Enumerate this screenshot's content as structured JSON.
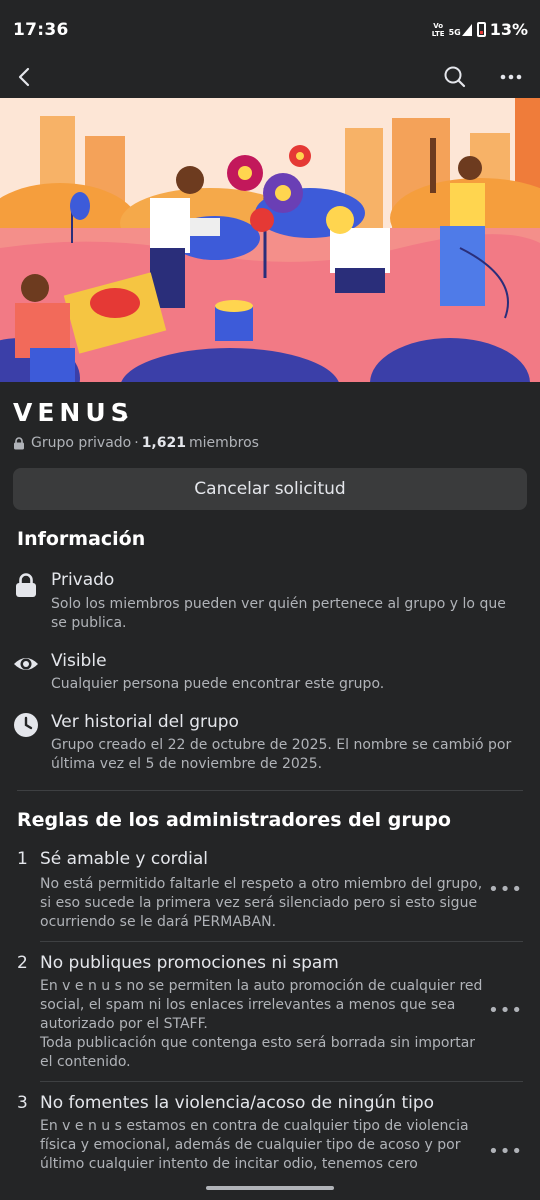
{
  "status_bar": {
    "time": "17:36",
    "volte": "Vo\nLTE",
    "network": "5G",
    "battery": "13%"
  },
  "app_bar": {
    "back_icon": "back-arrow-icon",
    "search_icon": "search-icon",
    "more_icon": "more-options-icon"
  },
  "group": {
    "name": "VENUS",
    "chevron": "›",
    "privacy": "Grupo privado",
    "separator": "·",
    "members_count": "1,621",
    "members_label": "miembros",
    "cancel_button": "Cancelar solicitud"
  },
  "info": {
    "title": "Información",
    "items": [
      {
        "icon": "lock-icon",
        "title": "Privado",
        "desc": "Solo los miembros pueden ver quién pertenece al grupo y lo que se publica."
      },
      {
        "icon": "eye-icon",
        "title": "Visible",
        "desc": "Cualquier persona puede encontrar este grupo."
      },
      {
        "icon": "clock-icon",
        "title": "Ver historial del grupo",
        "desc": "Grupo creado el 22 de octubre de 2025. El nombre se cambió por última vez el 5 de noviembre de 2025."
      }
    ]
  },
  "rules": {
    "title": "Reglas de los administradores del grupo",
    "items": [
      {
        "num": "1",
        "title": "Sé amable y cordial",
        "desc": "No está permitido faltarle el respeto a otro miembro del grupo, si eso sucede la primera vez será silenciado pero si esto sigue ocurriendo se le dará PERMABAN."
      },
      {
        "num": "2",
        "title": "No publiques promociones ni spam",
        "desc": "En  v e n u s  no se permiten la auto promoción de cualquier red social, el spam ni los enlaces irrelevantes a menos que sea autorizado por el STAFF.\nToda publicación que contenga esto será borrada sin importar el contenido."
      },
      {
        "num": "3",
        "title": "No fomentes la violencia/acoso de ningún tipo",
        "desc": "En  v e n u s  estamos en contra de cualquier tipo de violencia física y emocional, además de cualquier tipo de acoso y por último cualquier intento de incitar odio, tenemos cero"
      }
    ],
    "more_label": "•••"
  }
}
